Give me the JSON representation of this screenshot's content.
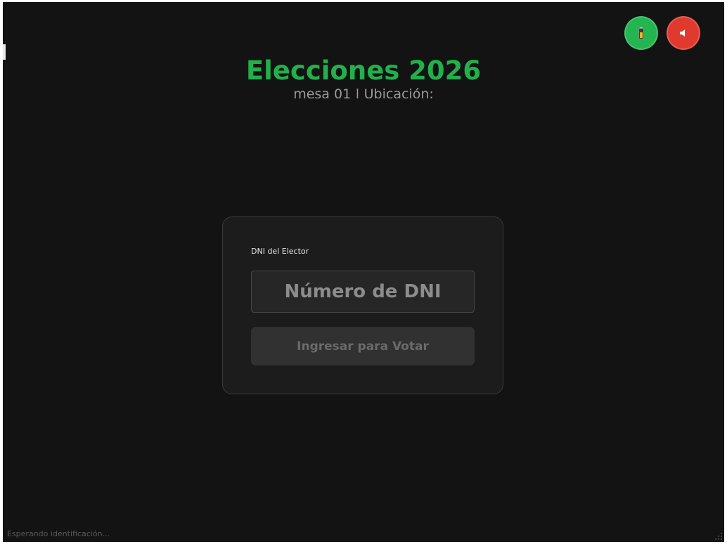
{
  "header": {
    "title": "Elecciones 2026",
    "subtitle": "mesa 01 | Ubicación:"
  },
  "toolbar": {
    "battery_icon": "battery-icon",
    "mute_icon": "speaker-muted-icon",
    "battery_color": "#22b550",
    "mute_color": "#e03a2f"
  },
  "login": {
    "label": "DNI del Elector",
    "input_value": "",
    "input_placeholder": "Número de DNI",
    "submit_label": "Ingresar para Votar"
  },
  "status": {
    "text": "Esperando identificación..."
  },
  "theme": {
    "background": "#131313",
    "accent": "#22b04b",
    "card": "#1c1c1c"
  }
}
